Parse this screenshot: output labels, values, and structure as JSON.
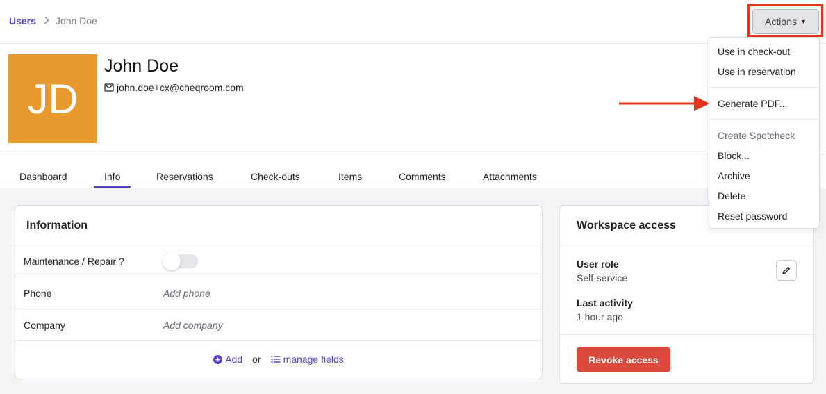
{
  "breadcrumb": {
    "parent": "Users",
    "current": "John Doe"
  },
  "header": {
    "actions_label": "Actions"
  },
  "profile": {
    "initials": "JD",
    "name": "John Doe",
    "email": "john.doe+cx@cheqroom.com",
    "avatar_color": "#e89b2c"
  },
  "tabs": [
    {
      "label": "Dashboard"
    },
    {
      "label": "Info",
      "active": true
    },
    {
      "label": "Reservations"
    },
    {
      "label": "Check-outs"
    },
    {
      "label": "Items"
    },
    {
      "label": "Comments"
    },
    {
      "label": "Attachments"
    }
  ],
  "information": {
    "title": "Information",
    "rows": [
      {
        "label": "Maintenance / Repair ?",
        "type": "toggle",
        "checked": false
      },
      {
        "label": "Phone",
        "placeholder": "Add phone"
      },
      {
        "label": "Company",
        "placeholder": "Add company"
      }
    ],
    "footer": {
      "add_label": "Add",
      "or_label": "or",
      "manage_label": "manage fields"
    }
  },
  "workspace": {
    "title": "Workspace access",
    "user_role_label": "User role",
    "user_role_value": "Self-service",
    "last_activity_label": "Last activity",
    "last_activity_value": "1 hour ago",
    "revoke_label": "Revoke access"
  },
  "dropdown": {
    "items": [
      {
        "label": "Use in check-out"
      },
      {
        "label": "Use in reservation"
      },
      {
        "label": "Generate PDF..."
      },
      {
        "label": "Create Spotcheck",
        "disabled": true
      },
      {
        "label": "Block..."
      },
      {
        "label": "Archive"
      },
      {
        "label": "Delete"
      },
      {
        "label": "Reset password"
      }
    ]
  },
  "colors": {
    "accent": "#5b3fd1",
    "danger": "#db4a3c",
    "highlight": "#e5341d"
  }
}
